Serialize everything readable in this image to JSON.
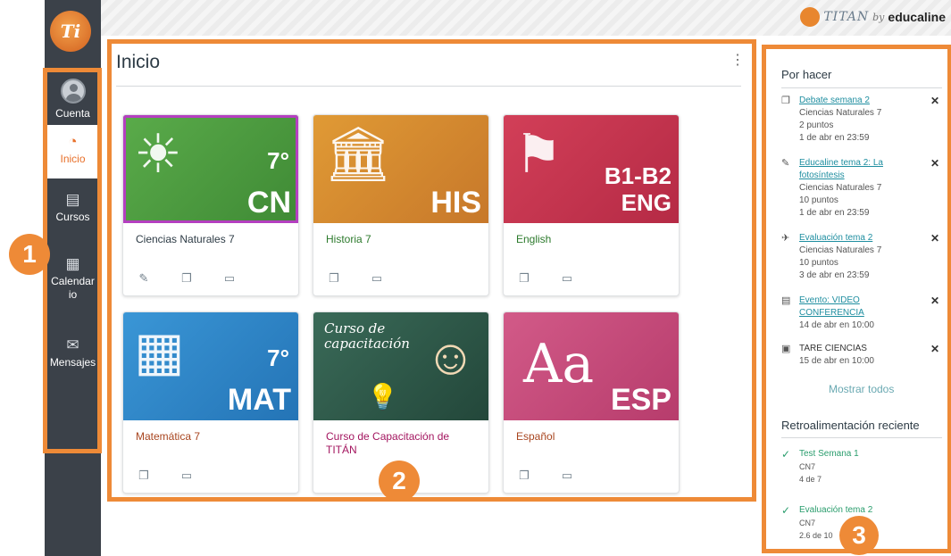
{
  "brand": {
    "titan": "TITAN",
    "by": "by",
    "name": "educaline"
  },
  "logo": {
    "text": "Ti"
  },
  "nav": [
    {
      "label": "Cuenta",
      "icon": "avatar-icon"
    },
    {
      "label": "Inicio",
      "icon": "dashboard-icon",
      "active": true
    },
    {
      "label": "Cursos",
      "icon": "book-icon"
    },
    {
      "label": "Calendar io",
      "icon": "calendar-icon"
    },
    {
      "label": "Mensajes",
      "icon": "inbox-icon"
    }
  ],
  "main": {
    "title": "Inicio",
    "menu_icon": "⋮"
  },
  "cards": [
    {
      "title": "Ciencias Naturales 7",
      "code": "CN",
      "grade": "7°",
      "color": "#4a9a3f",
      "title_color": "#2d3b45",
      "icons": [
        "assignments-icon",
        "discussions-icon",
        "files-icon"
      ]
    },
    {
      "title": "Historia 7",
      "code": "HIS",
      "grade": "",
      "color": "#d48a2a",
      "title_color": "#2c7a2c",
      "icons": [
        "discussions-icon",
        "files-icon"
      ]
    },
    {
      "title": "English",
      "code": "B1-B2 ENG",
      "grade": "",
      "color": "#c9334f",
      "title_color": "#2c7a2c",
      "icons": [
        "discussions-icon",
        "files-icon"
      ]
    },
    {
      "title": "Matemática 7",
      "code": "MAT",
      "grade": "7°",
      "color": "#2a86c9",
      "title_color": "#a8451f",
      "icons": [
        "discussions-icon",
        "files-icon"
      ]
    },
    {
      "title": "Curso de Capacitación de TITÁN",
      "code": "",
      "grade": "",
      "color": "#2f5a4a",
      "title_color": "#a3155f",
      "icons": [],
      "chalk": "Curso de capacitación"
    },
    {
      "title": "Español",
      "code": "ESP",
      "grade": "",
      "color": "#c34a7a",
      "title_color": "#a8451f",
      "icons": [
        "discussions-icon",
        "files-icon"
      ]
    }
  ],
  "todo": {
    "heading": "Por hacer",
    "items": [
      {
        "icon": "discussion-icon",
        "title": "Debate semana 2",
        "course": "Ciencias Naturales 7",
        "points": "2 puntos",
        "due": "1 de abr en 23:59",
        "link": true
      },
      {
        "icon": "assignment-icon",
        "title": "Educaline tema 2: La fotosíntesis",
        "course": "Ciencias Naturales 7",
        "points": "10 puntos",
        "due": "1 de abr en 23:59",
        "link": true
      },
      {
        "icon": "quiz-icon",
        "title": "Evaluación tema 2",
        "course": "Ciencias Naturales 7",
        "points": "10 puntos",
        "due": "3 de abr en 23:59",
        "link": true
      },
      {
        "icon": "event-icon",
        "title": "Evento: VIDEO CONFERENCIA",
        "course": "",
        "points": "",
        "due": "14 de abr en 10:00",
        "link": true
      },
      {
        "icon": "task-icon",
        "title": "TARE CIENCIAS",
        "course": "",
        "points": "",
        "due": "15 de abr en 10:00",
        "link": false
      }
    ],
    "show_all": "Mostrar todos"
  },
  "feedback": {
    "heading": "Retroalimentación reciente",
    "items": [
      {
        "title": "Test Semana 1",
        "course": "CN7",
        "score": "4 de 7"
      },
      {
        "title": "Evaluación tema 2",
        "course": "CN7",
        "score": "2.6 de 10"
      }
    ]
  },
  "callouts": [
    "1",
    "2",
    "3"
  ],
  "colors": {
    "accent": "#ee8a37",
    "nav_bg": "#3b4149",
    "link": "#1f8ea0",
    "selected": "#b43fc0"
  }
}
